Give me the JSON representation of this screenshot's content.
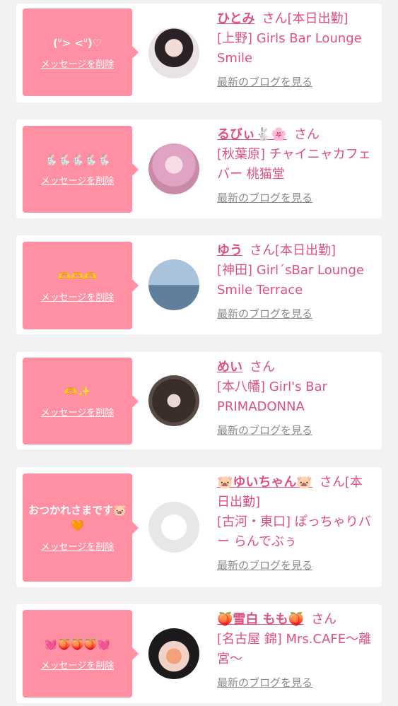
{
  "delete_label": "メッセージを削除",
  "blog_label": "最新のブログを見る",
  "san_label": "さん",
  "entries": [
    {
      "message": "(ᐡ> <ᐡ)♡",
      "name": "ひとみ",
      "suffix": "[本日出勤]",
      "shop": "[上野] Girls Bar Lounge Smile",
      "avatar_icon": "avatar-photo"
    },
    {
      "message": "🐇🐇🐇🐇🐇",
      "name": "るびぃ🐇🌸",
      "suffix": "",
      "shop": "[秋葉原] チャイニャカフェバー 桃猫堂",
      "avatar_icon": "avatar-photo"
    },
    {
      "message": "🫶🫶🫶",
      "name": "ゆう",
      "suffix": "[本日出勤]",
      "shop": "[神田] Girl´sBar Lounge Smile Terrace",
      "avatar_icon": "avatar-photo"
    },
    {
      "message": "🫶✨",
      "name": "めい",
      "suffix": "",
      "shop": "[本八幡] Girl's Bar PRIMADONNA",
      "avatar_icon": "avatar-photo"
    },
    {
      "message": "おつかれさまです🐷🧡",
      "name": "🐷ゆいちゃん🐷",
      "suffix": "[本日出勤]",
      "shop": "[古河・東口] ぽっちゃりバー らんでぶぅ",
      "avatar_icon": "avatar-photo"
    },
    {
      "message": "💓🍑🍑🍑💓",
      "name": "🍑雪白 もも🍑",
      "suffix": "",
      "shop": "[名古屋 錦] Mrs.CAFE～離宮～",
      "avatar_icon": "avatar-photo"
    }
  ],
  "colors": {
    "accent": "#e0507e",
    "bubble": "#ff8fa3",
    "background": "#f2f2f2",
    "card": "#ffffff",
    "link_gray": "#8a8a8a"
  }
}
